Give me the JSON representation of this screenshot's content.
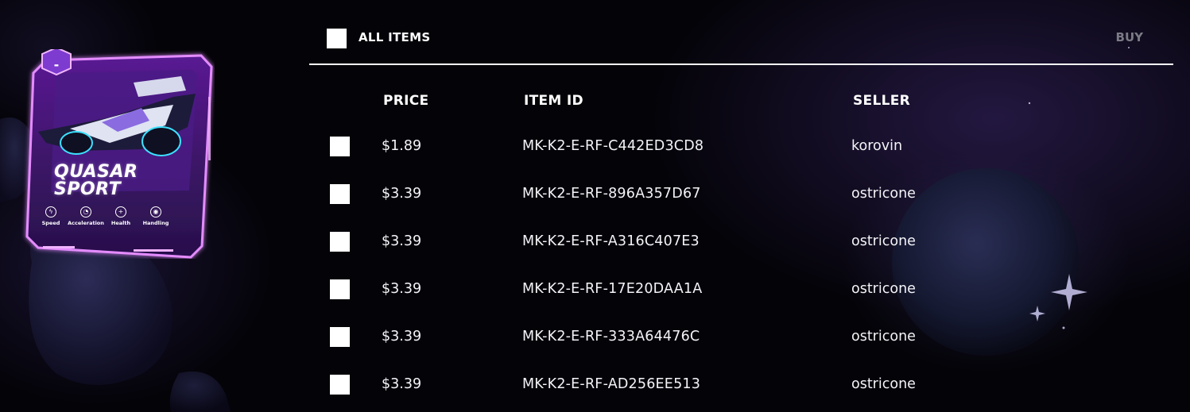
{
  "card": {
    "badge": "-",
    "title_line1": "QUASAR",
    "title_line2": "SPORT",
    "stats": [
      {
        "label": "Speed",
        "icon": "lightning-icon"
      },
      {
        "label": "Acceleration",
        "icon": "gauge-icon"
      },
      {
        "label": "Health",
        "icon": "shield-icon"
      },
      {
        "label": "Handling",
        "icon": "steering-wheel-icon"
      }
    ],
    "colors": {
      "frame": "#c45cf0",
      "inner": "#3a1466",
      "glow": "#e58bff"
    }
  },
  "toolbar": {
    "all_items_label": "ALL ITEMS",
    "buy_label": "BUY"
  },
  "table": {
    "columns": [
      "PRICE",
      "ITEM ID",
      "SELLER"
    ],
    "rows": [
      {
        "price": "$1.89",
        "item_id": "MK-K2-E-RF-C442ED3CD8",
        "seller": "korovin"
      },
      {
        "price": "$3.39",
        "item_id": "MK-K2-E-RF-896A357D67",
        "seller": "ostricone"
      },
      {
        "price": "$3.39",
        "item_id": "MK-K2-E-RF-A316C407E3",
        "seller": "ostricone"
      },
      {
        "price": "$3.39",
        "item_id": "MK-K2-E-RF-17E20DAA1A",
        "seller": "ostricone"
      },
      {
        "price": "$3.39",
        "item_id": "MK-K2-E-RF-333A64476C",
        "seller": "ostricone"
      },
      {
        "price": "$3.39",
        "item_id": "MK-K2-E-RF-AD256EE513",
        "seller": "ostricone"
      }
    ]
  },
  "theme": {
    "background": "#040308",
    "text": "#ffffff",
    "muted": "#7b7b86",
    "checkbox": "#ffffff"
  }
}
